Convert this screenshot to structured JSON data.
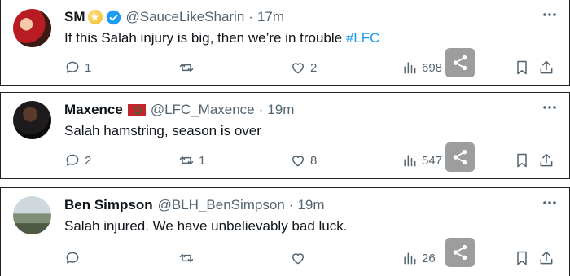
{
  "tweets": [
    {
      "name": "SM",
      "handle": "@SauceLikeSharin",
      "time": "17m",
      "text_main": "If this Salah injury is big, then we’re in trouble ",
      "hashtag": "#LFC",
      "replies": "1",
      "retweets": "",
      "likes": "2",
      "views": "698",
      "badges": [
        "star-badge-icon",
        "verified-badge-icon"
      ]
    },
    {
      "name": "Maxence",
      "handle": "@LFC_Maxence",
      "time": "19m",
      "text_main": "Salah hamstring, season is over",
      "hashtag": "",
      "replies": "2",
      "retweets": "1",
      "likes": "8",
      "views": "547",
      "badges": [
        "flag-icon"
      ]
    },
    {
      "name": "Ben Simpson",
      "handle": "@BLH_BenSimpson",
      "time": "19m",
      "text_main": "Salah injured. We have unbelievably bad luck.",
      "hashtag": "",
      "replies": "",
      "retweets": "",
      "likes": "",
      "views": "26",
      "badges": []
    }
  ],
  "separator": "·",
  "colors": {
    "text": "#0f1419",
    "secondary": "#536471",
    "link": "#1d9bf0",
    "verified": "#1d9bf0",
    "share_overlay": "#8c8c8c"
  }
}
